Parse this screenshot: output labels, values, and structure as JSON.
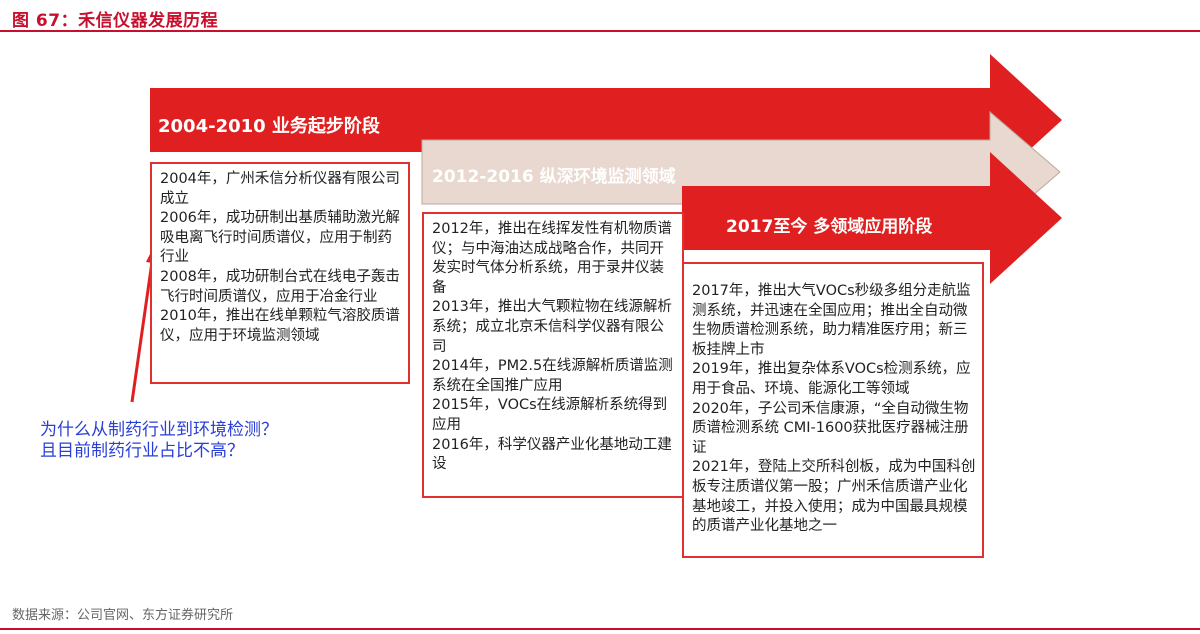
{
  "figure": {
    "title": "图 67：禾信仪器发展历程",
    "source": "数据来源：公司官网、东方证券研究所"
  },
  "colors": {
    "red": "#e02020",
    "tan": "#e8d8cf",
    "handwriting": "#2a3fd6"
  },
  "stages": [
    {
      "label": "2004-2010 业务起步阶段",
      "items": [
        "2004年，广州禾信分析仪器有限公司成立",
        "2006年，成功研制出基质辅助激光解吸电离飞行时间质谱仪，应用于制药行业",
        "2008年，成功研制台式在线电子轰击飞行时间质谱仪，应用于冶金行业",
        "2010年，推出在线单颗粒气溶胶质谱仪，应用于环境监测领域"
      ]
    },
    {
      "label": "2012-2016 纵深环境监测领域",
      "items": [
        "2012年，推出在线挥发性有机物质谱仪；与中海油达成战略合作，共同开发实时气体分析系统，用于录井仪装备",
        "2013年，推出大气颗粒物在线源解析系统；成立北京禾信科学仪器有限公司",
        "2014年，PM2.5在线源解析质谱监测系统在全国推广应用",
        "2015年，VOCs在线源解析系统得到应用",
        "2016年，科学仪器产业化基地动工建设"
      ]
    },
    {
      "label": "2017至今 多领域应用阶段",
      "items": [
        "2017年，推出大气VOCs秒级多组分走航监测系统，并迅速在全国应用；推出全自动微生物质谱检测系统，助力精准医疗用；新三板挂牌上市",
        "2019年，推出复杂体系VOCs检测系统，应用于食品、环境、能源化工等领域",
        "2020年，子公司禾信康源，“全自动微生物质谱检测系统 CMI-1600获批医疗器械注册证",
        "2021年，登陆上交所科创板，成为中国科创板专注质谱仪第一股；广州禾信质谱产业化基地竣工，并投入使用；成为中国最具规模的质谱产业化基地之一"
      ]
    }
  ],
  "annotation": {
    "line1": "为什么从制药行业到环境检测？",
    "line2": "且目前制药行业占比不高？"
  }
}
